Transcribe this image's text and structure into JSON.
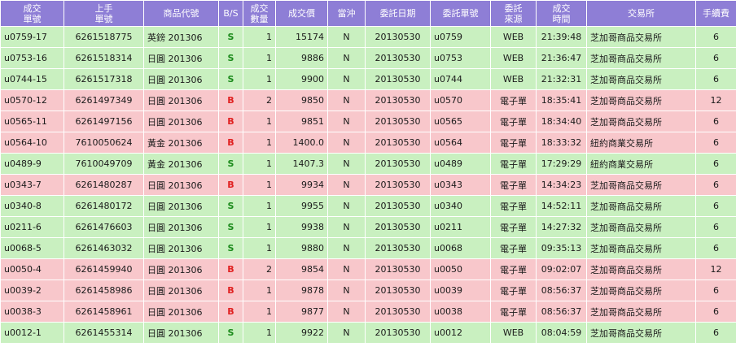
{
  "headers": [
    "成交\n單號",
    "上手\n單號",
    "商品代號",
    "B/S",
    "成交\n數量",
    "成交價",
    "當沖",
    "委託日期",
    "委託單號",
    "委託\n來源",
    "成交\n時間",
    "交易所",
    "手續費"
  ],
  "rows": [
    {
      "trade_no": "u0759-17",
      "upper_no": "6261518775",
      "product": "英鎊 201306",
      "bs": "S",
      "qty": "1",
      "price": "15174",
      "daytrade": "N",
      "order_date": "20130530",
      "order_no": "u0759",
      "source": "WEB",
      "time": "21:39:48",
      "exchange": "芝加哥商品交易所",
      "fee": "6"
    },
    {
      "trade_no": "u0753-16",
      "upper_no": "6261518314",
      "product": "日圓 201306",
      "bs": "S",
      "qty": "1",
      "price": "9886",
      "daytrade": "N",
      "order_date": "20130530",
      "order_no": "u0753",
      "source": "WEB",
      "time": "21:36:47",
      "exchange": "芝加哥商品交易所",
      "fee": "6"
    },
    {
      "trade_no": "u0744-15",
      "upper_no": "6261517318",
      "product": "日圓 201306",
      "bs": "S",
      "qty": "1",
      "price": "9900",
      "daytrade": "N",
      "order_date": "20130530",
      "order_no": "u0744",
      "source": "WEB",
      "time": "21:32:31",
      "exchange": "芝加哥商品交易所",
      "fee": "6"
    },
    {
      "trade_no": "u0570-12",
      "upper_no": "6261497349",
      "product": "日圓 201306",
      "bs": "B",
      "qty": "2",
      "price": "9850",
      "daytrade": "N",
      "order_date": "20130530",
      "order_no": "u0570",
      "source": "電子單",
      "time": "18:35:41",
      "exchange": "芝加哥商品交易所",
      "fee": "12"
    },
    {
      "trade_no": "u0565-11",
      "upper_no": "6261497156",
      "product": "日圓 201306",
      "bs": "B",
      "qty": "1",
      "price": "9851",
      "daytrade": "N",
      "order_date": "20130530",
      "order_no": "u0565",
      "source": "電子單",
      "time": "18:34:40",
      "exchange": "芝加哥商品交易所",
      "fee": "6"
    },
    {
      "trade_no": "u0564-10",
      "upper_no": "7610050624",
      "product": "黃金 201306",
      "bs": "B",
      "qty": "1",
      "price": "1400.0",
      "daytrade": "N",
      "order_date": "20130530",
      "order_no": "u0564",
      "source": "電子單",
      "time": "18:33:32",
      "exchange": "紐約商業交易所",
      "fee": "6"
    },
    {
      "trade_no": "u0489-9",
      "upper_no": "7610049709",
      "product": "黃金 201306",
      "bs": "S",
      "qty": "1",
      "price": "1407.3",
      "daytrade": "N",
      "order_date": "20130530",
      "order_no": "u0489",
      "source": "電子單",
      "time": "17:29:29",
      "exchange": "紐約商業交易所",
      "fee": "6"
    },
    {
      "trade_no": "u0343-7",
      "upper_no": "6261480287",
      "product": "日圓 201306",
      "bs": "B",
      "qty": "1",
      "price": "9934",
      "daytrade": "N",
      "order_date": "20130530",
      "order_no": "u0343",
      "source": "電子單",
      "time": "14:34:23",
      "exchange": "芝加哥商品交易所",
      "fee": "6"
    },
    {
      "trade_no": "u0340-8",
      "upper_no": "6261480172",
      "product": "日圓 201306",
      "bs": "S",
      "qty": "1",
      "price": "9955",
      "daytrade": "N",
      "order_date": "20130530",
      "order_no": "u0340",
      "source": "電子單",
      "time": "14:52:11",
      "exchange": "芝加哥商品交易所",
      "fee": "6"
    },
    {
      "trade_no": "u0211-6",
      "upper_no": "6261476603",
      "product": "日圓 201306",
      "bs": "S",
      "qty": "1",
      "price": "9938",
      "daytrade": "N",
      "order_date": "20130530",
      "order_no": "u0211",
      "source": "電子單",
      "time": "14:27:32",
      "exchange": "芝加哥商品交易所",
      "fee": "6"
    },
    {
      "trade_no": "u0068-5",
      "upper_no": "6261463032",
      "product": "日圓 201306",
      "bs": "S",
      "qty": "1",
      "price": "9880",
      "daytrade": "N",
      "order_date": "20130530",
      "order_no": "u0068",
      "source": "電子單",
      "time": "09:35:13",
      "exchange": "芝加哥商品交易所",
      "fee": "6"
    },
    {
      "trade_no": "u0050-4",
      "upper_no": "6261459940",
      "product": "日圓 201306",
      "bs": "B",
      "qty": "2",
      "price": "9854",
      "daytrade": "N",
      "order_date": "20130530",
      "order_no": "u0050",
      "source": "電子單",
      "time": "09:02:07",
      "exchange": "芝加哥商品交易所",
      "fee": "12"
    },
    {
      "trade_no": "u0039-2",
      "upper_no": "6261458986",
      "product": "日圓 201306",
      "bs": "B",
      "qty": "1",
      "price": "9878",
      "daytrade": "N",
      "order_date": "20130530",
      "order_no": "u0039",
      "source": "電子單",
      "time": "08:56:37",
      "exchange": "芝加哥商品交易所",
      "fee": "6"
    },
    {
      "trade_no": "u0038-3",
      "upper_no": "6261458961",
      "product": "日圓 201306",
      "bs": "B",
      "qty": "1",
      "price": "9877",
      "daytrade": "N",
      "order_date": "20130530",
      "order_no": "u0038",
      "source": "電子單",
      "time": "08:56:37",
      "exchange": "芝加哥商品交易所",
      "fee": "6"
    },
    {
      "trade_no": "u0012-1",
      "upper_no": "6261455314",
      "product": "日圓 201306",
      "bs": "S",
      "qty": "1",
      "price": "9922",
      "daytrade": "N",
      "order_date": "20130530",
      "order_no": "u0012",
      "source": "WEB",
      "time": "08:04:59",
      "exchange": "芝加哥商品交易所",
      "fee": "6"
    }
  ],
  "colors": {
    "header_bg": "#8e7ed6",
    "sell_row": "#c9f0c0",
    "buy_row": "#f8c7cb",
    "sell_text": "#1b8a1b",
    "buy_text": "#e02020"
  }
}
